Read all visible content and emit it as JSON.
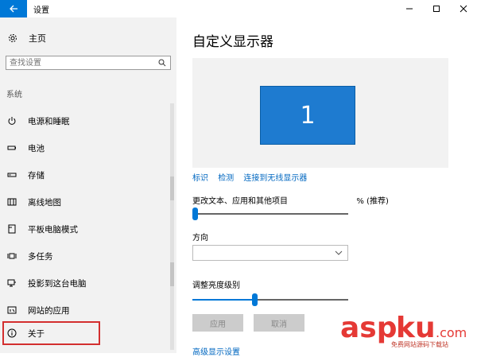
{
  "window": {
    "title": "设置"
  },
  "sidebar": {
    "home_label": "主页",
    "search_placeholder": "查找设置",
    "section_label": "系统",
    "items": [
      {
        "label": "电源和睡眠",
        "icon": "power-icon"
      },
      {
        "label": "电池",
        "icon": "battery-icon"
      },
      {
        "label": "存储",
        "icon": "storage-icon"
      },
      {
        "label": "离线地图",
        "icon": "offline-maps-icon"
      },
      {
        "label": "平板电脑模式",
        "icon": "tablet-mode-icon"
      },
      {
        "label": "多任务",
        "icon": "multitasking-icon"
      },
      {
        "label": "投影到这台电脑",
        "icon": "project-icon"
      },
      {
        "label": "网站的应用",
        "icon": "apps-for-websites-icon"
      },
      {
        "label": "关于",
        "icon": "info-icon"
      }
    ]
  },
  "main": {
    "title": "自定义显示器",
    "monitor_number": "1",
    "links": [
      "标识",
      "检测",
      "连接到无线显示器"
    ],
    "scale_label_left": "更改文本、应用和其他项目",
    "scale_label_right": "% (推荐)",
    "orientation_label": "方向",
    "orientation_value": "",
    "brightness_label": "调整亮度级别",
    "brightness_level": 0.4,
    "scale_level": 0.0,
    "apply_button": "应用",
    "cancel_button": "取消",
    "advanced_link": "高级显示设置"
  },
  "watermark": {
    "brand": "aspku",
    "suffix": ".com",
    "tagline": "免费网站源码下载站"
  },
  "colors": {
    "accent": "#0078d7",
    "sidebar_bg": "#f2f2f2",
    "highlight_box": "#d32f2f",
    "watermark": "#e53935"
  }
}
